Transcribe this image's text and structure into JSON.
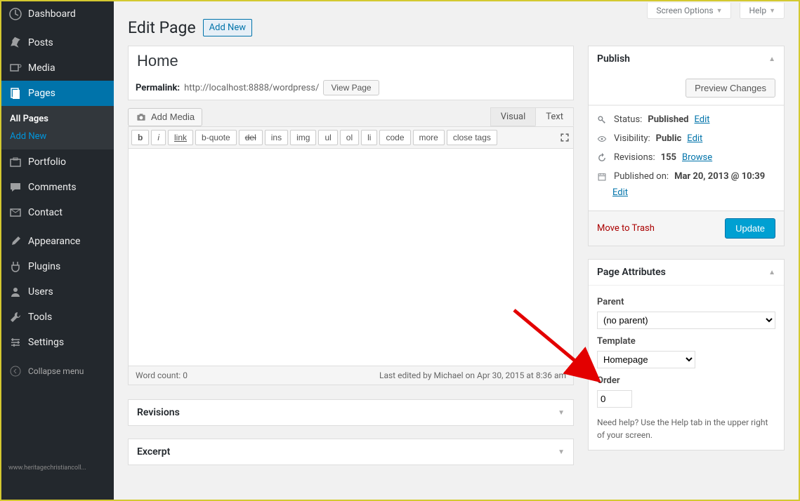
{
  "sidebar": {
    "items": [
      {
        "label": "Dashboard",
        "icon": "dashboard-icon"
      },
      {
        "label": "Posts",
        "icon": "pin-icon"
      },
      {
        "label": "Media",
        "icon": "media-icon"
      },
      {
        "label": "Pages",
        "icon": "pages-icon"
      },
      {
        "label": "Portfolio",
        "icon": "portfolio-icon"
      },
      {
        "label": "Comments",
        "icon": "comments-icon"
      },
      {
        "label": "Contact",
        "icon": "envelope-icon"
      },
      {
        "label": "Appearance",
        "icon": "brush-icon"
      },
      {
        "label": "Plugins",
        "icon": "plug-icon"
      },
      {
        "label": "Users",
        "icon": "users-icon"
      },
      {
        "label": "Tools",
        "icon": "tools-icon"
      },
      {
        "label": "Settings",
        "icon": "settings-icon"
      }
    ],
    "submenu": {
      "all_pages": "All Pages",
      "add_new": "Add New"
    },
    "collapse": "Collapse menu",
    "watermark": "www.heritagechristiancoll..."
  },
  "top_tabs": {
    "screen_options": "Screen Options",
    "help": "Help"
  },
  "header": {
    "title": "Edit Page",
    "add_new": "Add New"
  },
  "page": {
    "title_value": "Home",
    "permalink_label": "Permalink:",
    "permalink_url": "http://localhost:8888/wordpress/",
    "view_page": "View Page"
  },
  "media": {
    "add_media": "Add Media"
  },
  "editor": {
    "tabs": {
      "visual": "Visual",
      "text": "Text"
    },
    "quicktags": [
      "b",
      "i",
      "link",
      "b-quote",
      "del",
      "ins",
      "img",
      "ul",
      "ol",
      "li",
      "code",
      "more",
      "close tags"
    ],
    "word_count_label": "Word count:",
    "word_count": "0",
    "last_edited": "Last edited by Michael on Apr 30, 2015 at 8:36 am"
  },
  "postboxes": {
    "revisions_title": "Revisions",
    "excerpt_title": "Excerpt"
  },
  "publish": {
    "title": "Publish",
    "preview": "Preview Changes",
    "status_label": "Status:",
    "status_value": "Published",
    "edit": "Edit",
    "visibility_label": "Visibility:",
    "visibility_value": "Public",
    "revisions_label": "Revisions:",
    "revisions_count": "155",
    "browse": "Browse",
    "published_label": "Published on:",
    "published_value": "Mar 20, 2013 @ 10:39",
    "trash": "Move to Trash",
    "update": "Update"
  },
  "attributes": {
    "title": "Page Attributes",
    "parent_label": "Parent",
    "parent_value": "(no parent)",
    "template_label": "Template",
    "template_value": "Homepage",
    "order_label": "Order",
    "order_value": "0",
    "help_text": "Need help? Use the Help tab in the upper right of your screen."
  }
}
